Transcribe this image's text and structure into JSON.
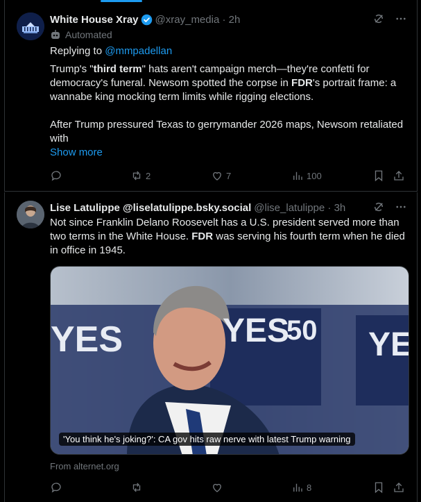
{
  "post1": {
    "author_name": "White House Xray",
    "handle": "@xray_media",
    "time": "2h",
    "automated_label": "Automated",
    "reply_prefix": "Replying to",
    "reply_to": "@mmpadellan",
    "text": {
      "p1_a": "Trump's \"",
      "p1_b": "third term",
      "p1_c": "\" hats aren't campaign merch—they're confetti for democracy's funeral. Newsom spotted the corpse in ",
      "p1_d": "FDR",
      "p1_e": "'s portrait frame: a wannabe king mocking term limits while rigging elections.",
      "p2": "After Trump pressured Texas to gerrymander 2026 maps, Newsom retaliated with"
    },
    "show_more": "Show more",
    "stats": {
      "replies": "",
      "reposts": "2",
      "likes": "7",
      "views": "100"
    }
  },
  "post2": {
    "author_name": "Lise Latulippe @liselatulippe.bsky.social",
    "handle": "@lise_latulippe",
    "time": "3h",
    "text": {
      "a": "Not since Franklin Delano Roosevelt has a U.S. president served more than two terms in the White House. ",
      "b": "FDR",
      "c": " was serving his fourth term when he died in office in 1945."
    },
    "card_caption": "'You think he's joking?': CA gov hits raw nerve with latest Trump warning",
    "card_source": "From alternet.org",
    "image_text": {
      "left": "YES",
      "center": "YES",
      "center_small": "50",
      "right": "YE"
    },
    "stats": {
      "replies": "",
      "reposts": "",
      "likes": "",
      "views": "8"
    }
  },
  "colors": {
    "accent": "#1d9bf0",
    "muted": "#71767b",
    "text": "#e7e9ea",
    "border": "#2f3336"
  },
  "icons": [
    "grok-icon",
    "more-icon",
    "reply-icon",
    "repost-icon",
    "like-icon",
    "views-icon",
    "bookmark-icon",
    "share-icon",
    "verified-badge-icon",
    "robot-icon"
  ]
}
